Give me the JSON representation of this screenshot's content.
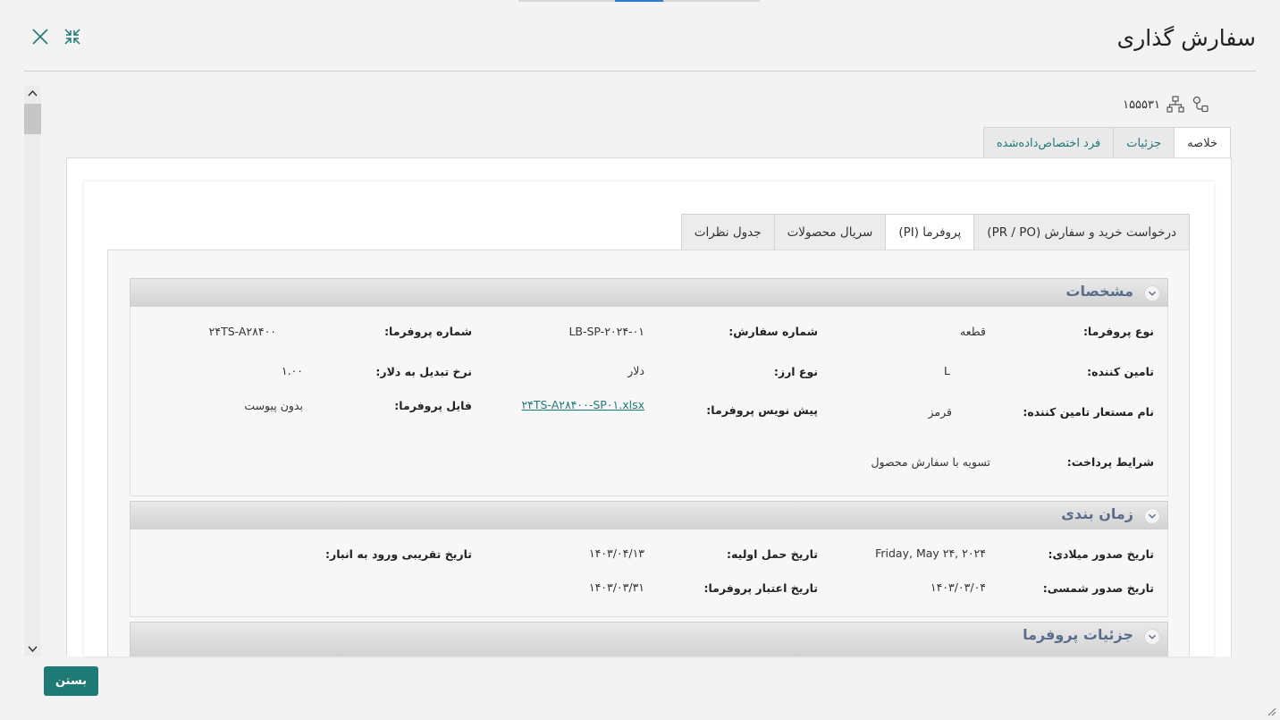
{
  "window": {
    "title": "سفارش گذاری"
  },
  "record": {
    "id": "۱۵۵۵۳۱"
  },
  "tabs_main": [
    {
      "label": "خلاصه",
      "active": true
    },
    {
      "label": "جزئیات",
      "active": false
    },
    {
      "label": "فرد اختصاص‌داده‌شده",
      "active": false
    }
  ],
  "tabs_sub": [
    {
      "label": "درخواست خرید و سفارش (PR / PO)",
      "active": false
    },
    {
      "label": "پروفرما (PI)",
      "active": true
    },
    {
      "label": "سریال محصولات",
      "active": false
    },
    {
      "label": "جدول نظرات",
      "active": false
    }
  ],
  "specs": {
    "title": "مشخصات",
    "fields": {
      "pi_type": {
        "label": "نوع پروفرما:",
        "value": "قطعه"
      },
      "order_no": {
        "label": "شماره سفارش:",
        "value": "LB-SP-۲۰۲۴-۰۱"
      },
      "pi_no": {
        "label": "شماره پروفرما:",
        "value": "۲۴TS-A۲۸۴۰۰"
      },
      "supplier": {
        "label": "تامین کننده:",
        "value": "L"
      },
      "currency": {
        "label": "نوع ارز:",
        "value": "دلار"
      },
      "rate": {
        "label": "نرخ تبدیل به دلار:",
        "value": "۱.۰۰"
      },
      "alias": {
        "label": "نام مستعار تامین کننده:",
        "value": "قرمز"
      },
      "draft": {
        "label": "پیش نویس پروفرما:",
        "value": "۲۴TS-A۲۸۴۰۰-SP۰۱.xlsx"
      },
      "file": {
        "label": "فایل پروفرما:",
        "value": "بدون پیوست"
      },
      "terms": {
        "label": "شرایط پرداخت:",
        "value": "تسویه با سفارش محصول"
      }
    }
  },
  "timing": {
    "title": "زمان بندی",
    "fields": {
      "issue_greg": {
        "label": "تاریخ صدور میلادی:",
        "value": "Friday, May ۲۴, ۲۰۲۴"
      },
      "first_ship": {
        "label": "تاریخ حمل اولیه:",
        "value": "۱۴۰۳/۰۴/۱۳"
      },
      "warehouse": {
        "label": "تاریخ تقریبی ورود به انبار:",
        "value": ""
      },
      "issue_sh": {
        "label": "تاریخ صدور شمسی:",
        "value": "۱۴۰۳/۰۳/۰۴"
      },
      "validity": {
        "label": "تاریخ اعتبار پروفرما:",
        "value": "۱۴۰۳/۰۳/۳۱"
      }
    }
  },
  "details": {
    "title": "جزئیات پروفرما"
  },
  "footer": {
    "close_label": "بستن"
  },
  "colors": {
    "accent": "#1f7a76",
    "section_title": "#5a6e8c"
  }
}
